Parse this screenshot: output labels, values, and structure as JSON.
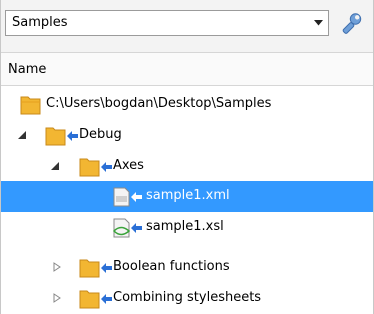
{
  "toolbar": {
    "combo_value": "Samples",
    "combo_arrow_icon": "chevron-down-icon",
    "settings_icon": "wrench-icon"
  },
  "header": {
    "column_name": "Name"
  },
  "tree": {
    "items": [
      {
        "label": "C:\\Users\\bogdan\\Desktop\\Samples",
        "icon": "folder-icon",
        "expander": "none",
        "selected": false
      },
      {
        "label": "Debug",
        "icon": "folder-link-icon",
        "expander": "expanded",
        "selected": false
      },
      {
        "label": "Axes",
        "icon": "folder-link-icon",
        "expander": "expanded",
        "selected": false
      },
      {
        "label": "sample1.xml",
        "icon": "xml-file-icon",
        "expander": "none",
        "selected": true
      },
      {
        "label": "sample1.xsl",
        "icon": "xsl-file-icon",
        "expander": "none",
        "selected": false
      },
      {
        "label": "Boolean functions",
        "icon": "folder-link-icon",
        "expander": "collapsed",
        "selected": false
      },
      {
        "label": "Combining stylesheets",
        "icon": "folder-link-icon",
        "expander": "collapsed",
        "selected": false
      }
    ]
  },
  "colors": {
    "selection": "#3399ff",
    "folder": "#f2b632",
    "link_arrow": "#2a6fd6",
    "xsl_green": "#3aa33a"
  }
}
